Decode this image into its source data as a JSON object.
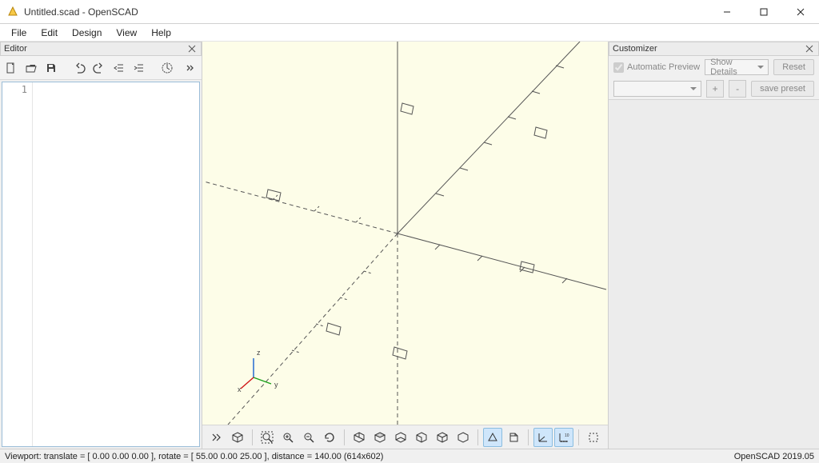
{
  "window": {
    "title": "Untitled.scad - OpenSCAD"
  },
  "menu": {
    "file": "File",
    "edit": "Edit",
    "design": "Design",
    "view": "View",
    "help": "Help"
  },
  "editor": {
    "panel_title": "Editor",
    "line1": "1"
  },
  "customizer": {
    "panel_title": "Customizer",
    "auto_preview": "Automatic Preview",
    "show_details": "Show Details",
    "reset": "Reset",
    "plus": "+",
    "minus": "-",
    "save_preset": "save preset"
  },
  "viewport": {
    "axis_labels": {
      "pos20a": "20",
      "neg20a": "-20",
      "pos20b": "20",
      "neg20b": "-20",
      "z": "z",
      "x": "x",
      "y": "y"
    }
  },
  "status": {
    "left": "Viewport: translate = [ 0.00 0.00 0.00 ], rotate = [ 55.00 0.00 25.00 ], distance = 140.00 (614x602)",
    "right": "OpenSCAD 2019.05"
  }
}
